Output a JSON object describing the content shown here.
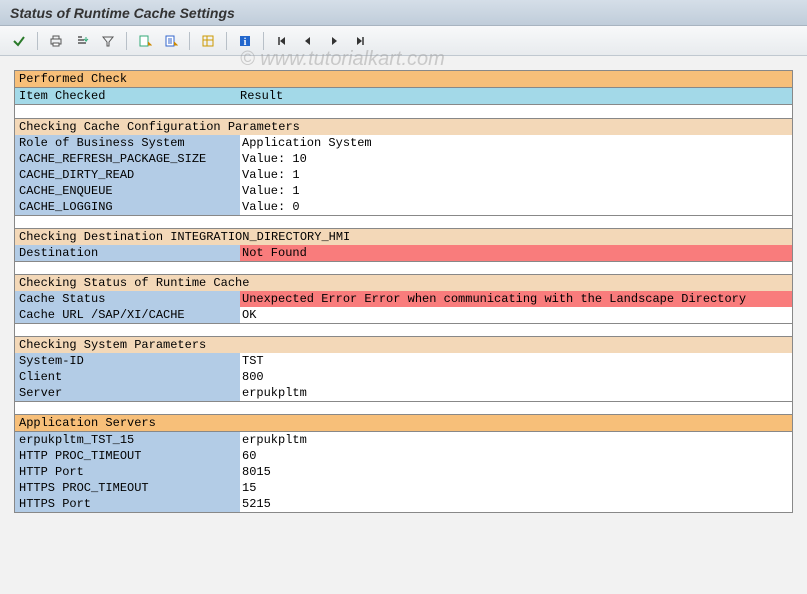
{
  "title": "Status of Runtime Cache Settings",
  "watermark": "© www.tutorialkart.com",
  "toolbar_icons": [
    "check",
    "print",
    "filter-asc",
    "filter",
    "export-xls",
    "export-doc",
    "grid",
    "info",
    "nav-first",
    "nav-prev",
    "nav-next",
    "nav-last"
  ],
  "sections": {
    "performed": {
      "header": "Performed Check",
      "col1": "Item Checked",
      "col2": "Result"
    },
    "cache_config": {
      "header": "Checking Cache Configuration Parameters",
      "rows": [
        {
          "label": "Role of Business System",
          "value": "Application System"
        },
        {
          "label": "CACHE_REFRESH_PACKAGE_SIZE",
          "value": "Value: 10"
        },
        {
          "label": "CACHE_DIRTY_READ",
          "value": "Value: 1"
        },
        {
          "label": "CACHE_ENQUEUE",
          "value": "Value: 1"
        },
        {
          "label": "CACHE_LOGGING",
          "value": "Value: 0"
        }
      ]
    },
    "destination": {
      "header": "Checking Destination INTEGRATION_DIRECTORY_HMI",
      "rows": [
        {
          "label": "Destination",
          "value": "Not Found",
          "error": true
        }
      ]
    },
    "runtime_cache": {
      "header": "Checking Status of Runtime Cache",
      "rows": [
        {
          "label": "Cache Status",
          "value": "Unexpected Error Error when communicating with the Landscape Directory",
          "error": true
        },
        {
          "label": "Cache URL /SAP/XI/CACHE",
          "value": "OK"
        }
      ]
    },
    "system_params": {
      "header": "Checking System Parameters",
      "rows": [
        {
          "label": "System-ID",
          "value": "TST"
        },
        {
          "label": "Client",
          "value": "800"
        },
        {
          "label": "Server",
          "value": "erpukpltm"
        }
      ]
    },
    "app_servers": {
      "header": "Application Servers",
      "rows": [
        {
          "label": "erpukpltm_TST_15",
          "value": "erpukpltm"
        },
        {
          "label": "HTTP PROC_TIMEOUT",
          "value": "60"
        },
        {
          "label": "HTTP Port",
          "value": "8015"
        },
        {
          "label": "HTTPS PROC_TIMEOUT",
          "value": "15"
        },
        {
          "label": "HTTPS Port",
          "value": "5215"
        }
      ]
    }
  }
}
